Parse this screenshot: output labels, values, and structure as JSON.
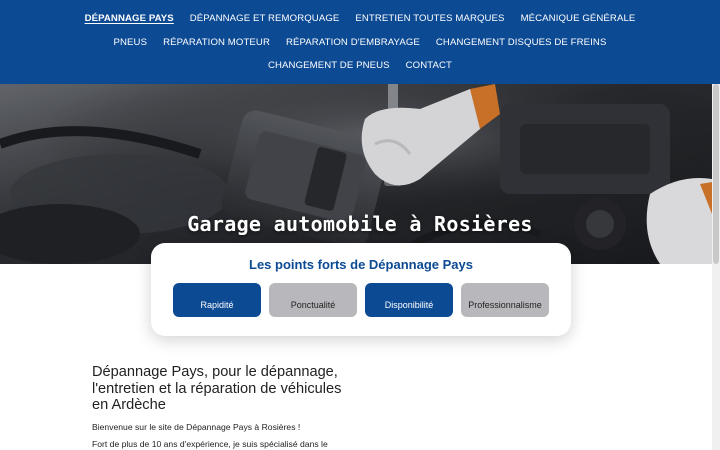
{
  "nav": {
    "row1": [
      "Dépannage Pays",
      "Dépannage et remorquage",
      "Entretien toutes marques",
      "Mécanique générale"
    ],
    "row2": [
      "Pneus",
      "Réparation moteur",
      "Réparation d'embrayage",
      "Changement disques de freins"
    ],
    "row3": [
      "Changement de pneus",
      "Contact"
    ]
  },
  "hero": {
    "title": "Garage automobile à Rosières"
  },
  "strengths": {
    "title": "Les points forts de Dépannage Pays",
    "items": [
      "Rapidité",
      "Ponctualité",
      "Disponibilité",
      "Professionnalisme"
    ]
  },
  "intro": {
    "heading": "Dépannage Pays, pour le dépannage, l'entretien et la réparation de véhicules  en Ardèche",
    "welcome": "Bienvenue sur le site de Dépannage Pays à Rosières !",
    "experience": "Fort de plus de 10 ans d'expérience, je suis spécialisé dans le"
  },
  "colors": {
    "brand": "#0c4a94",
    "pill_grey": "#b8b8bc"
  }
}
